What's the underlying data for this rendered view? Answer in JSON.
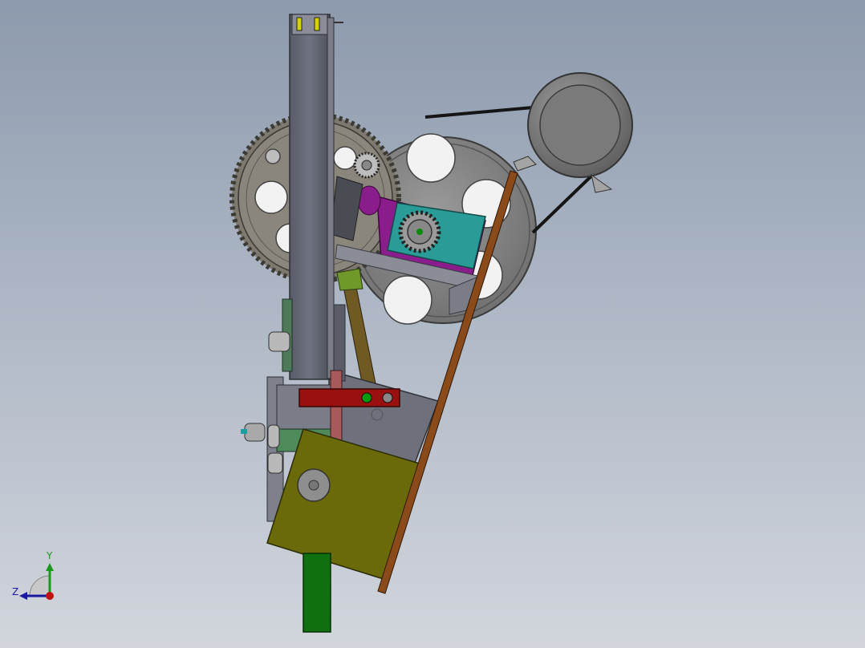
{
  "viewport": {
    "colors": {
      "bg_top": "#8d9aad",
      "bg_bottom": "#d2d5dc"
    }
  },
  "model": {
    "parts": [
      "vertical-column",
      "large-spur-gear",
      "spoked-pulley-wheel",
      "motor",
      "drive-belt",
      "small-sprocket",
      "cyan-bracket",
      "purple-link",
      "brown-rod",
      "red-link",
      "olive-plate",
      "green-post",
      "gray-housing",
      "diagonal-arm",
      "tensioner-arm"
    ],
    "colors": {
      "steel": "#6a6d78",
      "gear": "#7f7b72",
      "wheel": "#8a8a8a",
      "cyan": "#2a9c98",
      "purple": "#8b1c8c",
      "brown": "#8a4a1a",
      "red": "#9a1010",
      "olive": "#6a6a0a",
      "green": "#107010"
    }
  },
  "triad": {
    "y_label": "Y",
    "z_label": "Z",
    "colors": {
      "y": "#1a9a1a",
      "z": "#1a1aa0",
      "x": "#c01010"
    }
  }
}
